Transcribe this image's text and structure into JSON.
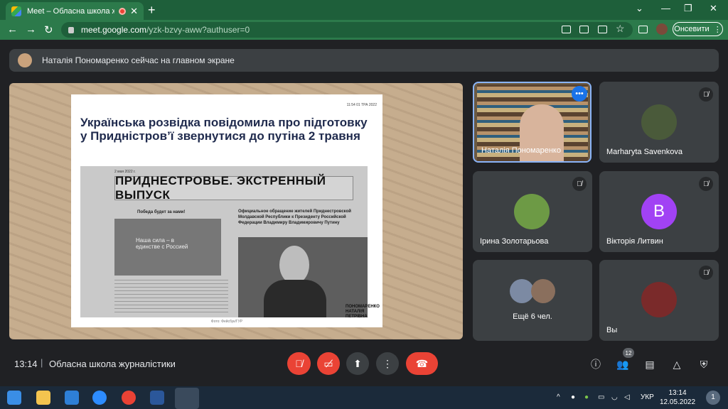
{
  "browser": {
    "tab_title": "Meet – Обласна школа жур",
    "new_tab": "+",
    "url_host": "meet.google.com",
    "url_path": "/yzk-bzvy-aww?authuser=0",
    "incognito_label": "Онсевити",
    "window_controls": [
      "chevron-down-icon",
      "minimize-icon",
      "restore-icon",
      "close-icon"
    ]
  },
  "banner": {
    "text": "Наталія Пономаренко сейчас на главном экране"
  },
  "slide": {
    "meta": "11:54 01 ТРА 2022",
    "headline": "Українська розвідка повідомила про підготовку у Придністров’ї звернутися до путіна 2 травня",
    "paper_date": "2 мая 2022 г.",
    "masthead": "ПРИДНЕСТРОВЬЕ. ЭКСТРЕННЫЙ ВЫПУСК",
    "subhead": "Победа будет за нами!",
    "appeal": "Официальное обращение жителей Приднестровской Молдавской Республики к Президенту Российской Федерации Владимиру Владимировичу Путину",
    "slogan": "Наша сила – в единстве с Россией",
    "credit": "Фото: Фейсбук/ГУР",
    "logo": "ПОНОМАРЕНКО НАТАЛІЯ ПЕТРІВНА"
  },
  "participants": [
    {
      "name": "Наталія Пономаренко",
      "muted": false,
      "active": true
    },
    {
      "name": "Marharyta Savenkova",
      "muted": true
    },
    {
      "name": "Ірина Золотарьова",
      "muted": true
    },
    {
      "name": "Вікторія Литвин",
      "muted": true,
      "initial": "B",
      "color": "#a142f4"
    },
    {
      "name": "Ещё 6 чел.",
      "muted": false
    },
    {
      "name": "Вы",
      "muted": true
    }
  ],
  "bottom": {
    "time": "13:14",
    "meeting_title": "Обласна школа журналістики",
    "people_count": "12"
  },
  "taskbar": {
    "lang": "УКР",
    "time": "13:14",
    "date": "12.05.2022",
    "notifications": "1"
  }
}
